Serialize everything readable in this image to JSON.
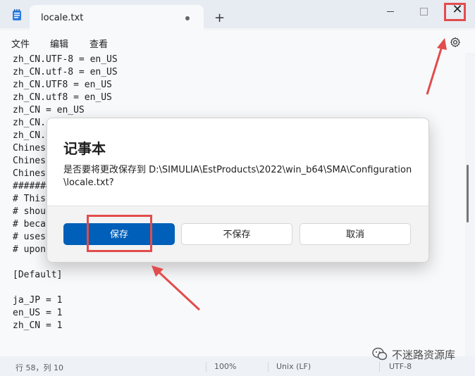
{
  "window": {
    "tab_title": "locale.txt",
    "new_tab": "+",
    "close_glyph": "✕"
  },
  "menu": {
    "file": "文件",
    "edit": "编辑",
    "view": "查看"
  },
  "editor": {
    "lines": [
      "zh_CN.UTF-8 = en_US",
      "zh_CN.utf-8 = en_US",
      "zh_CN.UTF8 = en_US",
      "zh_CN.utf8 = en_US",
      "zh_CN = en_US",
      "zh_CN.",
      "zh_CN.",
      "Chines",
      "Chines",
      "Chines",
      "#######",
      "# This",
      "# shou",
      "# beca",
      "# uses",
      "# upon",
      "",
      "[Default]",
      "",
      "ja_JP = 1",
      "en_US = 1",
      "zh_CN = 1",
      "",
      "",
      "#######################################################"
    ]
  },
  "status": {
    "position": "行 58，列 10",
    "zoom": "100%",
    "line_ending": "Unix (LF)",
    "encoding": "UTF-8"
  },
  "dialog": {
    "title": "记事本",
    "message_line1": "是否要将更改保存到 D:\\SIMULIA\\EstProducts\\2022\\win_b64\\SMA\\Configuration",
    "message_line2": "\\locale.txt?",
    "save": "保存",
    "dont_save": "不保存",
    "cancel": "取消"
  },
  "watermark": {
    "text": "不迷路资源库"
  },
  "colors": {
    "accent": "#005fb8",
    "annotation_red": "#e24c4c"
  },
  "icons": [
    "notepad-icon",
    "close-icon",
    "settings-gear-icon",
    "wechat-icon"
  ]
}
